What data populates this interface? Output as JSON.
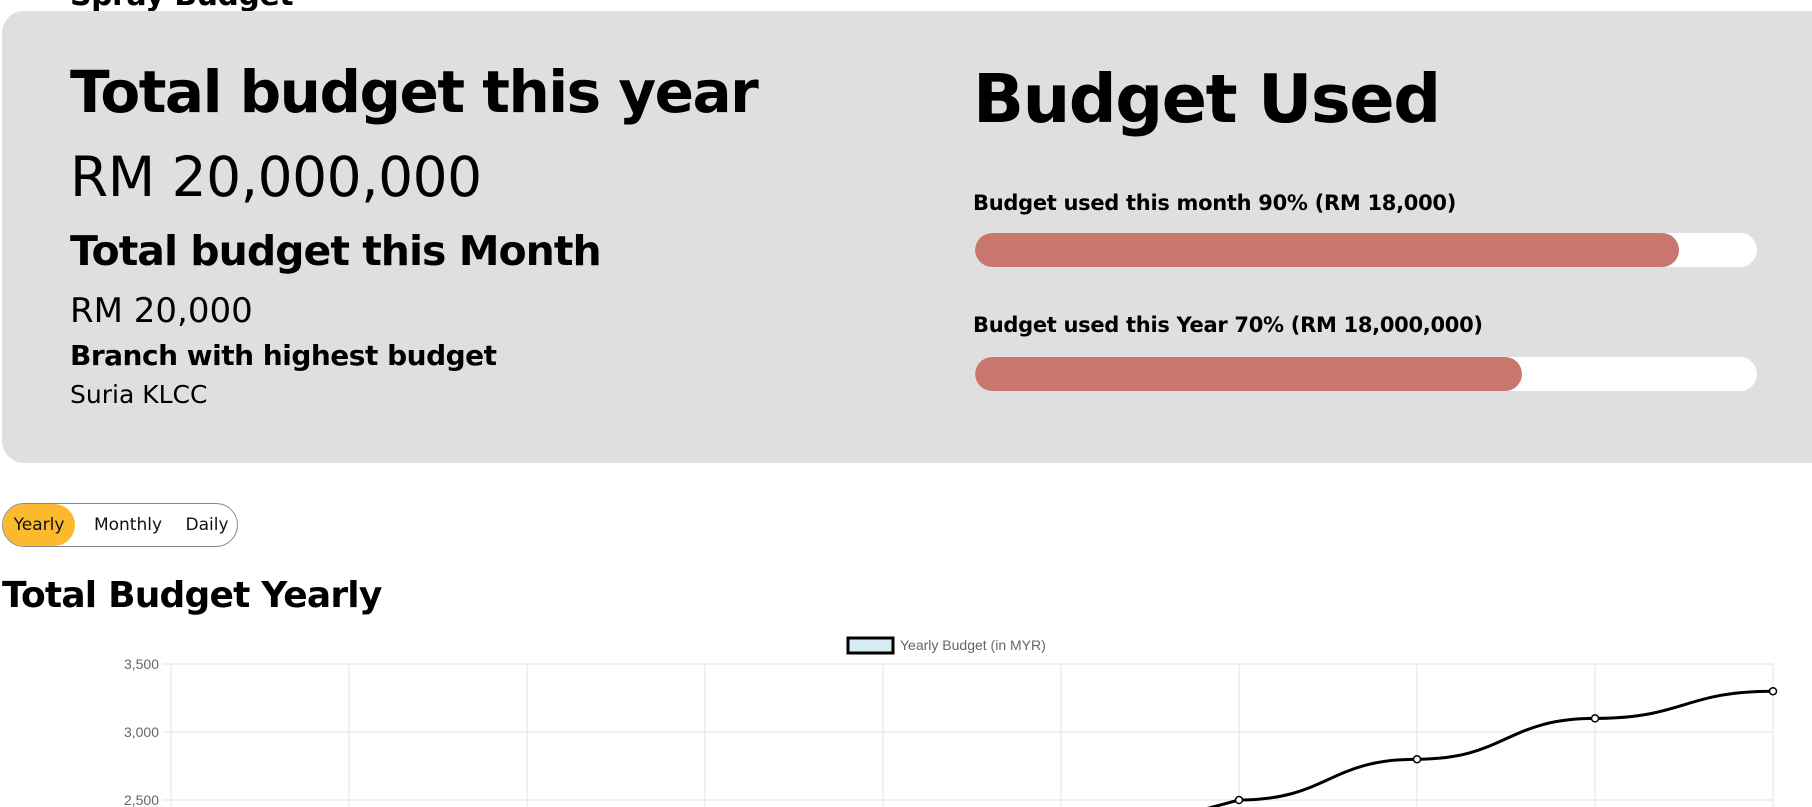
{
  "page": {
    "cut_heading": "Spray Budget"
  },
  "summary": {
    "total_year_title": "Total budget this year",
    "total_year_value": "RM 20,000,000",
    "total_month_title": "Total budget this Month",
    "total_month_value": "RM 20,000",
    "branch_title": "Branch with highest budget",
    "branch_value": "Suria KLCC"
  },
  "budget_used": {
    "title": "Budget Used",
    "month_label": "Budget used this month 90% (RM 18,000)",
    "month_percent": 90,
    "year_label": "Budget used this Year 70% (RM 18,000,000)",
    "year_percent": 70,
    "bar_color": "#c9766f"
  },
  "period_toggle": {
    "options": [
      "Yearly",
      "Monthly",
      "Daily"
    ],
    "selected": "Yearly",
    "active_color": "#fbb92d"
  },
  "chart_section": {
    "title": "Total Budget Yearly"
  },
  "chart_data": {
    "type": "line",
    "title": "",
    "legend": {
      "position": "top",
      "items": [
        "Yearly Budget (in MYR)"
      ]
    },
    "series": [
      {
        "name": "Yearly Budget (in MYR)",
        "values": [
          2500,
          2800,
          3100,
          3300
        ],
        "color": "#000000"
      }
    ],
    "x_index_visible": [
      6,
      7,
      8,
      9
    ],
    "x_count": 10,
    "y_ticks": [
      "3,500",
      "3,000",
      "2,500"
    ],
    "y_tick_values": [
      3500,
      3000,
      2500
    ],
    "ylim_visible": [
      2500,
      3500
    ],
    "grid": true
  }
}
